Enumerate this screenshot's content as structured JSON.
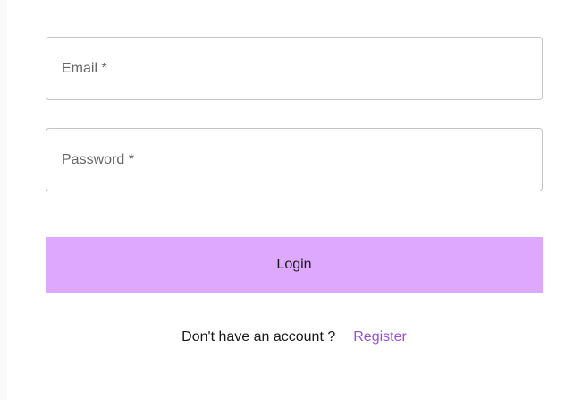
{
  "login_form": {
    "email": {
      "placeholder": "Email *",
      "value": ""
    },
    "password": {
      "placeholder": "Password *",
      "value": ""
    },
    "submit_label": "Login",
    "register_prompt": "Don't have an account ?",
    "register_link": "Register"
  },
  "colors": {
    "button_background": "#dfa8ff",
    "link": "#9c4dda",
    "field_border": "#c4c4c4"
  }
}
